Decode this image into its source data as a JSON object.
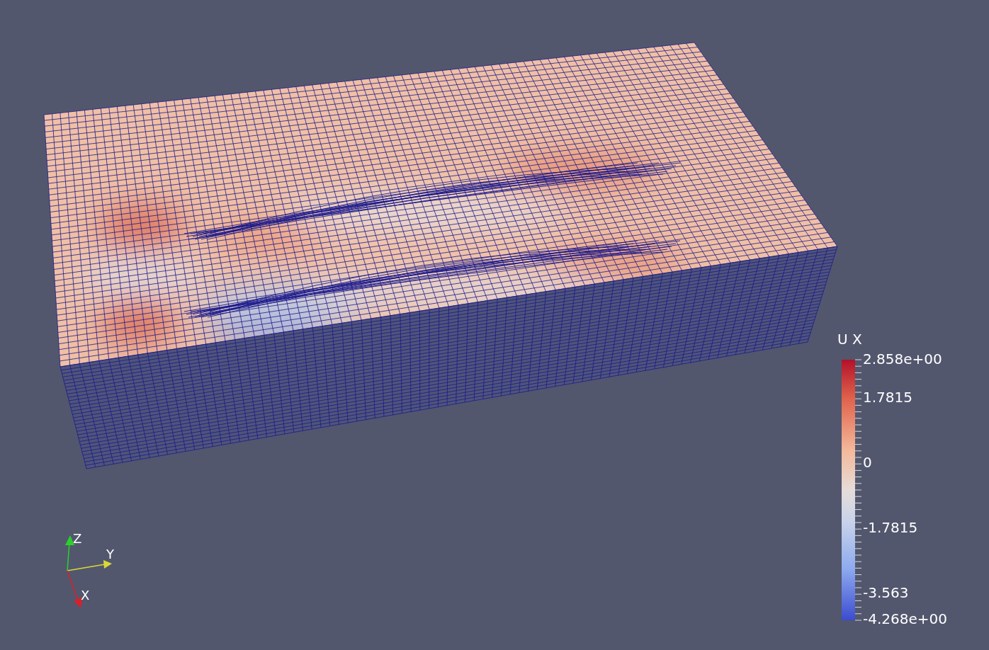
{
  "viewport": {
    "color_legend": {
      "title": "U X",
      "labels": [
        "2.858e+00",
        "1.7815",
        "0",
        "-1.7815",
        "-3.563",
        "-4.268e+00"
      ]
    },
    "axes_triad": {
      "labels": [
        "Z",
        "Y",
        "X"
      ]
    }
  }
}
